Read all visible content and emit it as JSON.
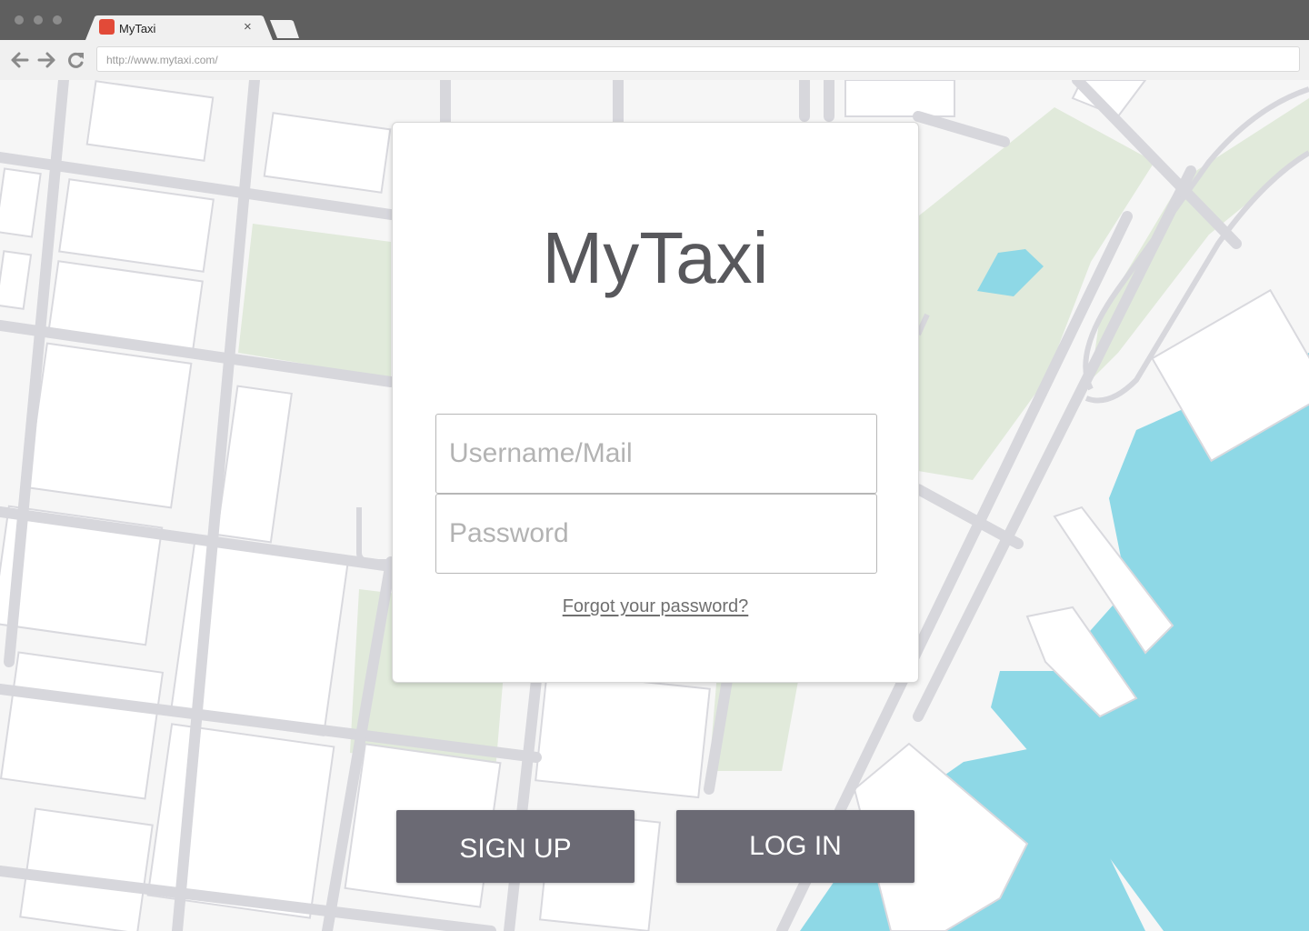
{
  "browser": {
    "tab_title": "MyTaxi",
    "tab_close": "×",
    "url": "http://www.mytaxi.com/",
    "icons": {
      "back": "arrow-left-icon",
      "forward": "arrow-right-icon",
      "reload": "reload-icon",
      "favicon": "favicon-icon",
      "close": "close-icon",
      "new_tab": "new-tab-icon"
    }
  },
  "login": {
    "brand": "MyTaxi",
    "username_placeholder": "Username/Mail",
    "password_placeholder": "Password",
    "forgot_link": "Forgot your password?"
  },
  "actions": {
    "signup_label": "SIGN UP",
    "login_label": "LOG IN"
  },
  "colors": {
    "button_bg": "#6b6a74",
    "favicon": "#e24a38",
    "map_water": "#8ed8e6",
    "map_park": "#e1eadb",
    "map_road": "#d7d7dc"
  }
}
